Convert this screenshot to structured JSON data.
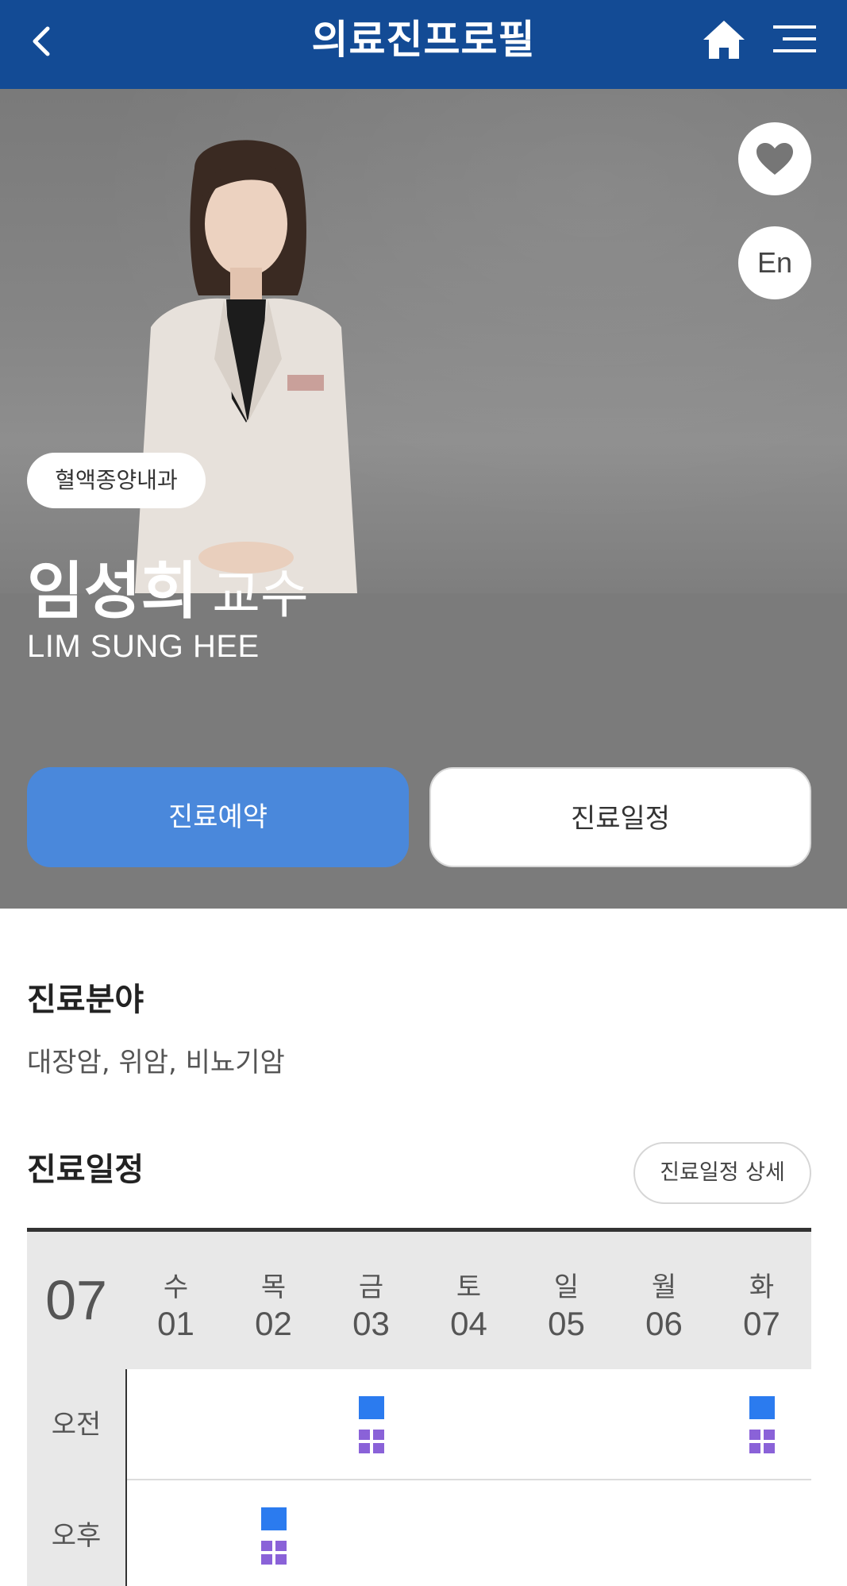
{
  "header": {
    "title": "의료진프로필",
    "back_icon": "chevron-left-icon",
    "home_icon": "home-icon",
    "menu_icon": "hamburger-menu-icon",
    "background_color": "#134b95"
  },
  "profile": {
    "favorite_icon": "heart-icon",
    "language_label": "En",
    "department": "혈액종양내과",
    "name": "임성희",
    "title": "교수",
    "name_en": "LIM SUNG HEE",
    "reserve_label": "진료예약",
    "schedule_label": "진료일정",
    "reserve_color": "#4a88db"
  },
  "specialty": {
    "heading": "진료분야",
    "text": "대장암, 위암, 비뇨기암"
  },
  "schedule": {
    "heading": "진료일정",
    "detail_label": "진료일정 상세",
    "month": "07",
    "days": [
      {
        "dow": "수",
        "date": "01"
      },
      {
        "dow": "목",
        "date": "02"
      },
      {
        "dow": "금",
        "date": "03"
      },
      {
        "dow": "토",
        "date": "04"
      },
      {
        "dow": "일",
        "date": "05"
      },
      {
        "dow": "월",
        "date": "06"
      },
      {
        "dow": "화",
        "date": "07"
      }
    ],
    "rows": [
      {
        "label": "오전",
        "clinic_days": [
          "03",
          "07"
        ]
      },
      {
        "label": "오후",
        "clinic_days": [
          "02"
        ]
      }
    ],
    "marker_colors": {
      "clinic": "#2b7bef",
      "secondary": "#8a62d8"
    }
  }
}
